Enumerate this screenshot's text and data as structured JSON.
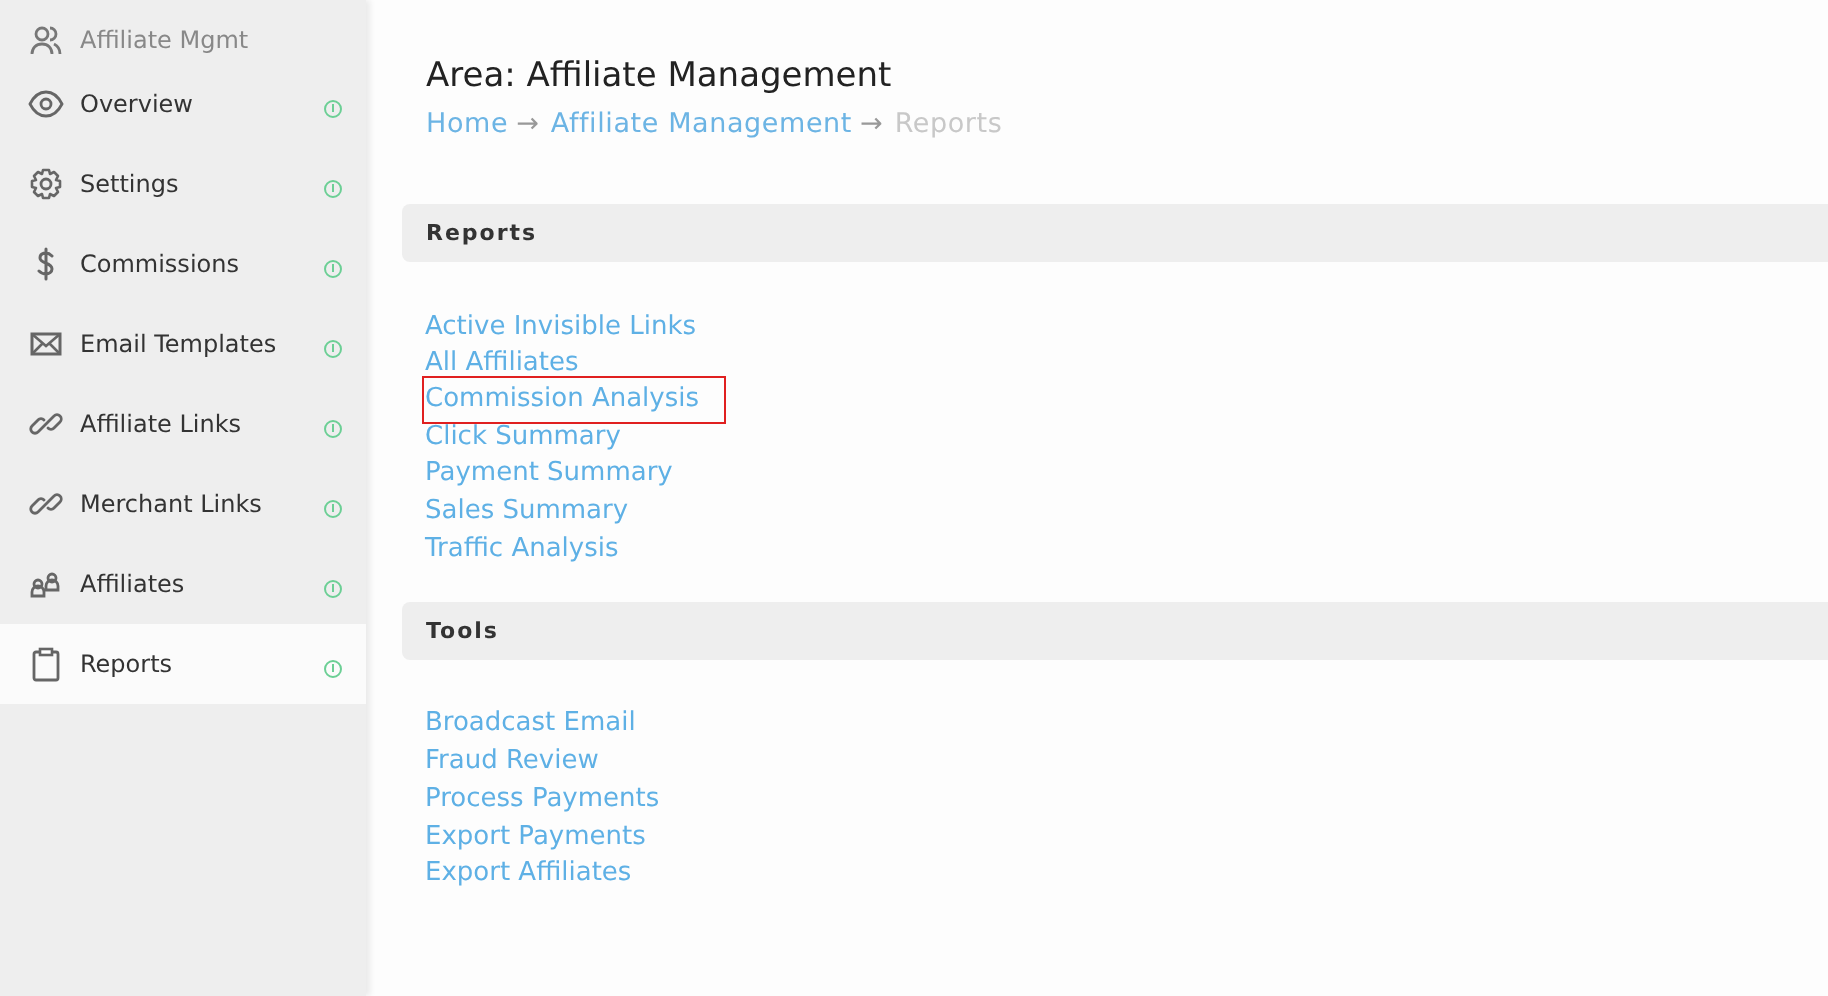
{
  "sidebar": {
    "header": {
      "label": "Affiliate Mgmt"
    },
    "items": [
      {
        "label": "Overview",
        "selected": false
      },
      {
        "label": "Settings",
        "selected": false
      },
      {
        "label": "Commissions",
        "selected": false
      },
      {
        "label": "Email Templates",
        "selected": false
      },
      {
        "label": "Affiliate Links",
        "selected": false
      },
      {
        "label": "Merchant Links",
        "selected": false
      },
      {
        "label": "Affiliates",
        "selected": false
      },
      {
        "label": "Reports",
        "selected": true
      }
    ]
  },
  "title": "Area: Affiliate Management",
  "breadcrumb": [
    {
      "label": "Home",
      "current": false,
      "separator": "→"
    },
    {
      "label": "Affiliate Management",
      "current": false,
      "separator": "→"
    },
    {
      "label": "Reports",
      "current": true
    }
  ],
  "sections": [
    {
      "title": "Reports",
      "links": [
        {
          "label": "Active Invisible Links",
          "highlighted": false
        },
        {
          "label": "All Affiliates",
          "highlighted": false
        },
        {
          "label": "Commission Analysis",
          "highlighted": true
        },
        {
          "label": "Click Summary",
          "highlighted": false
        },
        {
          "label": "Payment Summary",
          "highlighted": false
        },
        {
          "label": "Sales Summary",
          "highlighted": false
        },
        {
          "label": "Traffic Analysis",
          "highlighted": false
        }
      ]
    },
    {
      "title": "Tools",
      "links": [
        {
          "label": "Broadcast Email",
          "highlighted": false
        },
        {
          "label": "Fraud Review",
          "highlighted": false
        },
        {
          "label": "Process Payments",
          "highlighted": false
        },
        {
          "label": "Export Payments",
          "highlighted": false
        },
        {
          "label": "Export Affiliates",
          "highlighted": false
        }
      ]
    }
  ]
}
